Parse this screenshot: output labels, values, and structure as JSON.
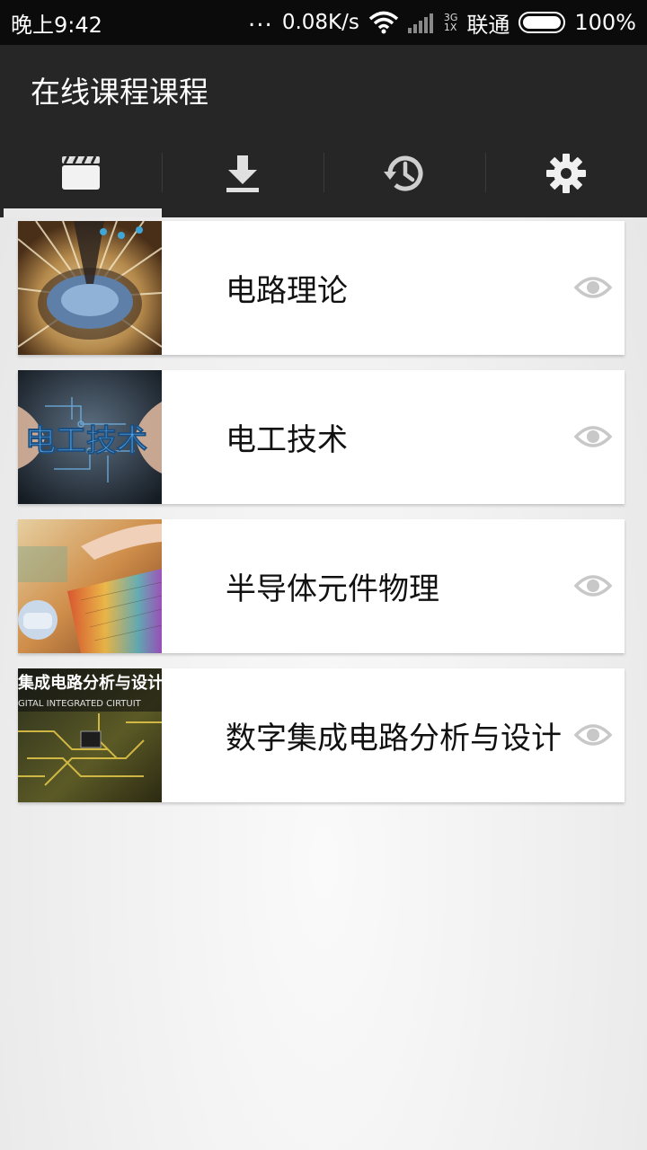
{
  "status_bar": {
    "time": "晚上9:42",
    "dots": "...",
    "net_speed": "0.08K/s",
    "net_type_top": "3G",
    "net_type_bottom": "1X",
    "carrier": "联通",
    "battery": "100%"
  },
  "app": {
    "title": "在线课程课程"
  },
  "tabs": [
    {
      "icon": "video-icon",
      "active": true
    },
    {
      "icon": "download-icon",
      "active": false
    },
    {
      "icon": "history-icon",
      "active": false
    },
    {
      "icon": "settings-icon",
      "active": false
    }
  ],
  "courses": [
    {
      "title": "电路理论",
      "thumb": "chip-probe-thumbnail"
    },
    {
      "title": "电工技术",
      "thumb": "circuit-hands-thumbnail",
      "thumb_text": "电工技术"
    },
    {
      "title": "半导体元件物理",
      "thumb": "wafer-hand-thumbnail"
    },
    {
      "title": "数字集成电路分析与设计",
      "thumb": "pcb-board-thumbnail",
      "thumb_text": "集成电路分析与设计",
      "thumb_subtext": "GITAL INTEGRATED CIRTUIT"
    }
  ],
  "colors": {
    "statusbar_bg": "#0b0b0b",
    "appbar_bg": "#262626",
    "tab_indicator": "#e9e9e9",
    "eye_icon": "#c8c8c8"
  }
}
